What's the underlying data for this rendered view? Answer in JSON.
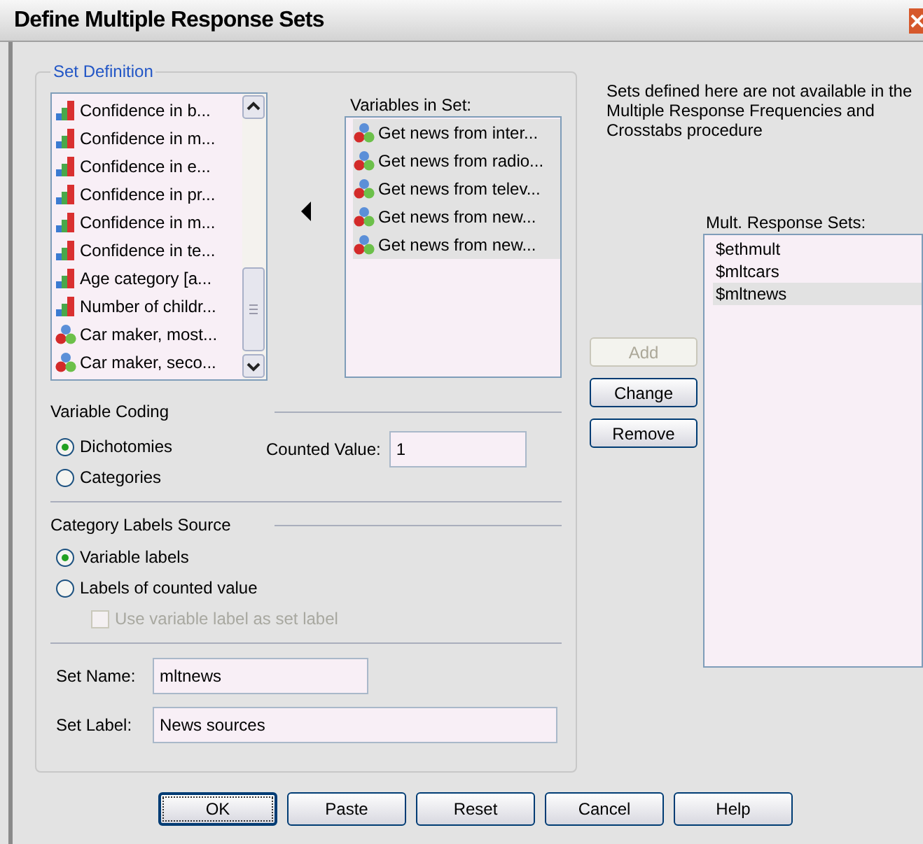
{
  "window": {
    "title": "Define Multiple Response Sets"
  },
  "set_definition": {
    "title": "Set Definition",
    "source_variables": [
      {
        "label": "Confidence in b...",
        "kind": "ordinal"
      },
      {
        "label": "Confidence in m...",
        "kind": "ordinal"
      },
      {
        "label": "Confidence in e...",
        "kind": "ordinal"
      },
      {
        "label": "Confidence in pr...",
        "kind": "ordinal"
      },
      {
        "label": "Confidence in m...",
        "kind": "ordinal"
      },
      {
        "label": "Confidence in te...",
        "kind": "ordinal"
      },
      {
        "label": "Age category [a...",
        "kind": "ordinal"
      },
      {
        "label": "Number of childr...",
        "kind": "ordinal"
      },
      {
        "label": "Car maker, most...",
        "kind": "nominal"
      },
      {
        "label": "Car maker, seco...",
        "kind": "nominal"
      }
    ],
    "variables_in_set": {
      "label": "Variables in Set:",
      "items": [
        {
          "label": "Get news from inter...",
          "kind": "nominal",
          "selected": true
        },
        {
          "label": "Get news from radio...",
          "kind": "nominal",
          "selected": true
        },
        {
          "label": "Get news from telev...",
          "kind": "nominal",
          "selected": true
        },
        {
          "label": "Get news from new...",
          "kind": "nominal",
          "selected": true
        },
        {
          "label": "Get news from new...",
          "kind": "nominal",
          "selected": true
        }
      ]
    },
    "variable_coding": {
      "title": "Variable Coding",
      "options": [
        {
          "label": "Dichotomies",
          "selected": true
        },
        {
          "label": "Categories",
          "selected": false
        }
      ],
      "counted_value": {
        "label": "Counted Value:",
        "value": "1"
      }
    },
    "category_labels_source": {
      "title": "Category Labels Source",
      "options": [
        {
          "label": "Variable labels",
          "selected": true
        },
        {
          "label": "Labels of counted value",
          "selected": false
        }
      ],
      "use_variable_label": {
        "label": "Use variable label as set label",
        "checked": false,
        "disabled": true
      }
    },
    "set_name": {
      "label": "Set Name:",
      "value": "mltnews"
    },
    "set_label": {
      "label": "Set Label:",
      "value": "News sources"
    }
  },
  "note": "Sets defined here are not available in the Multiple Response Frequencies and Crosstabs procedure",
  "action_buttons": [
    {
      "label": "Add",
      "disabled": true
    },
    {
      "label": "Change",
      "disabled": false
    },
    {
      "label": "Remove",
      "disabled": false
    }
  ],
  "mult_response_sets": {
    "label": "Mult. Response Sets:",
    "items": [
      {
        "label": "$ethmult",
        "selected": false
      },
      {
        "label": "$mltcars",
        "selected": false
      },
      {
        "label": "$mltnews",
        "selected": true
      }
    ]
  },
  "footer_buttons": [
    {
      "label": "OK",
      "default": true
    },
    {
      "label": "Paste",
      "default": false
    },
    {
      "label": "Reset",
      "default": false
    },
    {
      "label": "Cancel",
      "default": false
    },
    {
      "label": "Help",
      "default": false
    }
  ]
}
